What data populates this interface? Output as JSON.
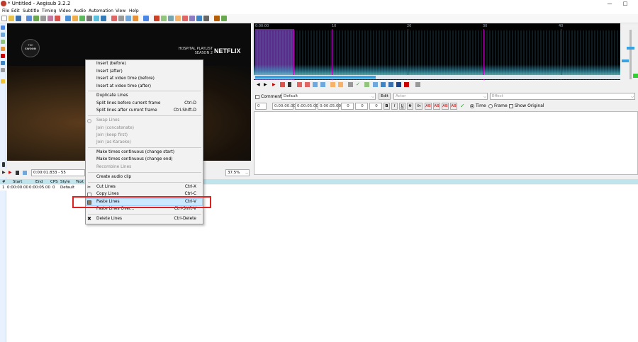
{
  "window": {
    "title": "* Untitled - Aegisub 3.2.2",
    "controls": [
      "—",
      "□"
    ]
  },
  "menu": [
    "File",
    "Edit",
    "Subtitle",
    "Timing",
    "Video",
    "Audio",
    "Automation",
    "View",
    "Help"
  ],
  "video": {
    "logo_line1": "THE",
    "logo_line2": "SWOON",
    "show_line1": "HOSPITAL PLAYLIST",
    "show_line2": "SEASON 2",
    "brand": "NETFLIX",
    "time": "0:00:01.833 - 55",
    "zoom": "37.5%"
  },
  "audio": {
    "ruler": [
      "0:00:00",
      "10",
      "20",
      "30",
      "40"
    ]
  },
  "edit": {
    "comment_label": "Comment",
    "style": "Default",
    "edit_button": "Edit",
    "actor_placeholder": "Actor",
    "effect_placeholder": "Effect",
    "layer": "0",
    "start": "0:00:00.00",
    "end": "0:00:05.00",
    "duration": "0:00:05.00",
    "margin_l": "0",
    "margin_r": "0",
    "margin_v": "0",
    "bold": "B",
    "italic": "I",
    "underline": "U",
    "strike": "S",
    "font": "fn",
    "color1": "AB",
    "color2": "AB",
    "color3": "AB",
    "color4": "AB",
    "time_label": "Time",
    "frame_label": "Frame",
    "show_original": "Show Original"
  },
  "grid": {
    "headers": [
      "#",
      "Start",
      "End",
      "CPS",
      "Style",
      "Text"
    ],
    "row": [
      "1",
      "0:00:00.00",
      "0:00:05.00",
      "0",
      "Default",
      ""
    ]
  },
  "context_menu": {
    "items": [
      {
        "label": "Insert (before)",
        "shortcut": "",
        "disabled": false
      },
      {
        "label": "Insert (after)",
        "shortcut": "",
        "disabled": false
      },
      {
        "label": "Insert at video time (before)",
        "shortcut": "",
        "disabled": false
      },
      {
        "label": "Insert at video time (after)",
        "shortcut": "",
        "disabled": false
      },
      {
        "label": "Duplicate Lines",
        "shortcut": "",
        "disabled": false
      },
      {
        "label": "Split lines before current frame",
        "shortcut": "Ctrl-D",
        "disabled": false
      },
      {
        "label": "Split lines after current frame",
        "shortcut": "Ctrl-Shift-D",
        "disabled": false
      },
      {
        "label": "Swap Lines",
        "shortcut": "",
        "disabled": true
      },
      {
        "label": "Join (concatenate)",
        "shortcut": "",
        "disabled": true
      },
      {
        "label": "Join (keep first)",
        "shortcut": "",
        "disabled": true
      },
      {
        "label": "Join (as Karaoke)",
        "shortcut": "",
        "disabled": true
      },
      {
        "label": "Make times continuous (change start)",
        "shortcut": "",
        "disabled": false
      },
      {
        "label": "Make times continuous (change end)",
        "shortcut": "",
        "disabled": false
      },
      {
        "label": "Recombine Lines",
        "shortcut": "",
        "disabled": true
      },
      {
        "label": "Create audio clip",
        "shortcut": "",
        "disabled": false
      },
      {
        "label": "Cut Lines",
        "shortcut": "Ctrl-X",
        "disabled": false
      },
      {
        "label": "Copy Lines",
        "shortcut": "Ctrl-C",
        "disabled": false
      },
      {
        "label": "Paste Lines",
        "shortcut": "Ctrl-V",
        "disabled": false
      },
      {
        "label": "Paste Lines Over...",
        "shortcut": "Ctrl-Shift-V",
        "disabled": false
      },
      {
        "label": "Delete Lines",
        "shortcut": "Ctrl-Delete",
        "disabled": false
      }
    ]
  },
  "colors": {
    "accent": "#3aa1e0",
    "highlight_box": "#e02020",
    "audio_selection": "#5b2d8a",
    "grid_header": "#bfe4ec"
  }
}
